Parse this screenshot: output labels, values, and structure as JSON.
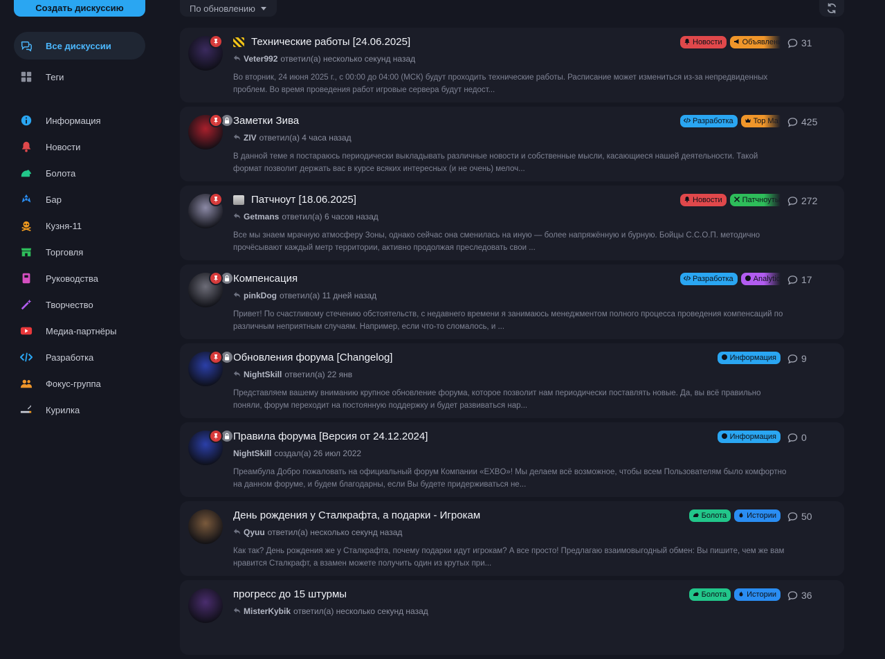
{
  "sidebar": {
    "create_button": "Создать дискуссию",
    "primary": [
      {
        "label": "Все дискуссии",
        "icon": "discussions-icon",
        "active": true
      },
      {
        "label": "Теги",
        "icon": "tags-grid-icon"
      }
    ],
    "tags": [
      {
        "label": "Информация",
        "icon": "info-icon",
        "color": "#2aa6f2"
      },
      {
        "label": "Новости",
        "icon": "bell-icon",
        "color": "#e0484b"
      },
      {
        "label": "Болота",
        "icon": "frog-icon",
        "color": "#22c68a"
      },
      {
        "label": "Бар",
        "icon": "radiation-icon",
        "color": "#2a8df2"
      },
      {
        "label": "Кузня-11",
        "icon": "skull-crossbones-icon",
        "color": "#f09a1e"
      },
      {
        "label": "Торговля",
        "icon": "store-icon",
        "color": "#2ebd5a"
      },
      {
        "label": "Руководства",
        "icon": "book-icon",
        "color": "#d54fc0"
      },
      {
        "label": "Творчество",
        "icon": "magic-wand-icon",
        "color": "#b25cf0"
      },
      {
        "label": "Медиа-партнёры",
        "icon": "youtube-icon",
        "color": "#e8383b"
      },
      {
        "label": "Разработка",
        "icon": "code-icon",
        "color": "#2aa6f2"
      },
      {
        "label": "Фокус-группа",
        "icon": "users-icon",
        "color": "#f0962a"
      },
      {
        "label": "Курилка",
        "icon": "cigarette-icon",
        "color": "#c9ccd6"
      }
    ]
  },
  "toolbar": {
    "sort_label": "По обновлению"
  },
  "discussions": [
    {
      "title": "Технические работы [24.06.2025]",
      "title_emoji": "construction-icon",
      "user": "Veter992",
      "action": "ответил(а) несколько секунд назад",
      "reply": true,
      "excerpt": "Во вторник, 24 июня 2025 г., с 00:00 до 04:00 (МСК) будут проходить технические работы. Расписание может измениться из-за непредвиденных проблем. Во время проведения работ игровые сервера будут недост...",
      "tags": [
        {
          "label": "Новости",
          "color": "#e0484b",
          "icon": "bell-icon"
        },
        {
          "label": "Объявления",
          "color": "#f0962a",
          "icon": "megaphone-icon"
        }
      ],
      "count": "31",
      "pinned": true,
      "locked": false,
      "avatar_color": "#3a2a5e"
    },
    {
      "title": "Заметки Зива",
      "title_emoji": "",
      "user": "ZIV",
      "action": "ответил(а) 4 часа назад",
      "reply": true,
      "excerpt": "В данной теме я постараюсь периодически выкладывать различные новости и собственные мысли, касающиеся нашей деятельности. Такой формат позволит держать вас в курсе всяких интересных (и не очень) мелоч...",
      "tags": [
        {
          "label": "Разработка",
          "color": "#2aa6f2",
          "icon": "code-icon"
        },
        {
          "label": "Top Ma",
          "color": "#f0962a",
          "icon": "crown-icon"
        }
      ],
      "count": "425",
      "pinned": true,
      "locked": true,
      "avatar_color": "#a8202c"
    },
    {
      "title": "Патчноут [18.06.2025]",
      "title_emoji": "newspaper-icon",
      "user": "Getmans",
      "action": "ответил(а) 6 часов назад",
      "reply": true,
      "excerpt": "Все мы знаем мрачную атмосферу Зоны, однако сейчас она сменилась на иную — более напряжённую и бурную. Бойцы С.С.О.П. методично прочёсывают каждый метр территории, активно продолжая преследовать свои ...",
      "tags": [
        {
          "label": "Новости",
          "color": "#e0484b",
          "icon": "bell-icon"
        },
        {
          "label": "Патчноуты",
          "color": "#2ebd5a",
          "icon": "tools-icon"
        }
      ],
      "count": "272",
      "pinned": true,
      "locked": false,
      "avatar_color": "#8c8aa6"
    },
    {
      "title": "Компенсация",
      "title_emoji": "",
      "user": "pinkDog",
      "action": "ответил(а) 11 дней назад",
      "reply": true,
      "excerpt": "Привет! По счастливому стечению обстоятельств, с недавнего времени я занимаюсь менеджментом полного процесса проведения компенсаций по различным неприятным случаям. Например, если что-то сломалось, и ...",
      "tags": [
        {
          "label": "Разработка",
          "color": "#2aa6f2",
          "icon": "code-icon"
        },
        {
          "label": "Analytic",
          "color": "#b25cf0",
          "icon": "chart-icon"
        }
      ],
      "count": "17",
      "pinned": true,
      "locked": true,
      "avatar_color": "#6d6d78"
    },
    {
      "title": "Обновления форума [Changelog]",
      "title_emoji": "",
      "user": "NightSkill",
      "action": "ответил(а) 22 янв",
      "reply": true,
      "excerpt": "Представляем вашему вниманию крупное обновление форума, которое позволит нам периодически поставлять новые. Да, вы всё правильно поняли, форум переходит на постоянную поддержку и будет развиваться нар...",
      "tags": [
        {
          "label": "Информация",
          "color": "#2aa6f2",
          "icon": "info-icon"
        }
      ],
      "count": "9",
      "pinned": true,
      "locked": true,
      "avatar_color": "#2b3fa8"
    },
    {
      "title": "Правила форума [Версия от 24.12.2024]",
      "title_emoji": "",
      "user": "NightSkill",
      "action": "создал(а) 26 июл 2022",
      "reply": false,
      "excerpt": "Преамбула Добро пожаловать на официальный форум Компании «EXBO»! Мы делаем всё возможное, чтобы всем Пользователям было комфортно на данном форуме, и будем благодарны, если Вы будете придерживаться не...",
      "tags": [
        {
          "label": "Информация",
          "color": "#2aa6f2",
          "icon": "info-icon"
        }
      ],
      "count": "0",
      "pinned": true,
      "locked": true,
      "avatar_color": "#2b3fa8"
    },
    {
      "title": "День рождения у Сталкрафта, а подарки - Игрокам",
      "title_emoji": "",
      "user": "Qyuu",
      "action": "ответил(а) несколько секунд назад",
      "reply": true,
      "excerpt": "Как так? День рождения же у Сталкрафта, почему подарки идут игрокам? А все просто! Предлагаю взаимовыгодный обмен: Вы пишите, чем же вам нравится Сталкрафт, а взамен можете получить один из крутых при...",
      "tags": [
        {
          "label": "Болота",
          "color": "#22c68a",
          "icon": "frog-icon"
        },
        {
          "label": "Истории",
          "color": "#2a8df2",
          "icon": "fire-icon"
        }
      ],
      "count": "50",
      "pinned": false,
      "locked": false,
      "avatar_color": "#7a5a3c"
    },
    {
      "title": "прогресс до 15 штурмы",
      "title_emoji": "",
      "user": "MisterKybik",
      "action": "ответил(а) несколько секунд назад",
      "reply": true,
      "excerpt": "",
      "tags": [
        {
          "label": "Болота",
          "color": "#22c68a",
          "icon": "frog-icon"
        },
        {
          "label": "Истории",
          "color": "#2a8df2",
          "icon": "fire-icon"
        }
      ],
      "count": "36",
      "pinned": false,
      "locked": false,
      "avatar_color": "#4a2d6e"
    }
  ]
}
